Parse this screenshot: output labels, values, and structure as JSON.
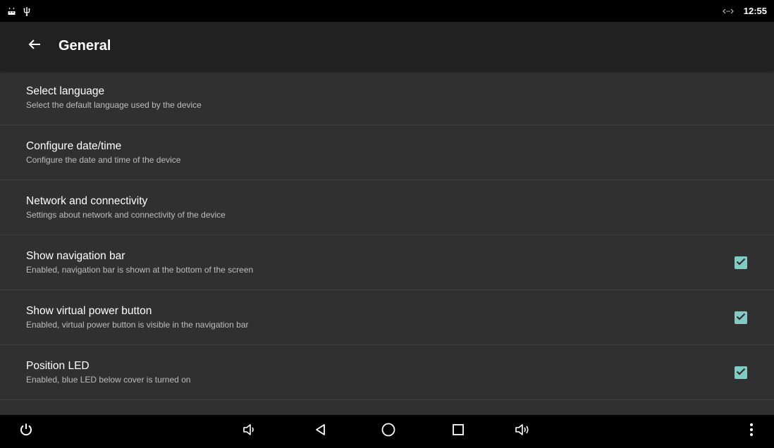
{
  "status_bar": {
    "time": "12:55",
    "left_icons": [
      "android-icon",
      "usb-icon"
    ],
    "right_icons": [
      "data-transfer-icon"
    ]
  },
  "action_bar": {
    "title": "General",
    "back_icon": "arrow-left-icon"
  },
  "settings": [
    {
      "title": "Select language",
      "summary": "Select the default language used by the device",
      "checkbox": null
    },
    {
      "title": "Configure date/time",
      "summary": "Configure the date and time of the device",
      "checkbox": null
    },
    {
      "title": "Network and connectivity",
      "summary": "Settings about network and connectivity of the device",
      "checkbox": null
    },
    {
      "title": "Show navigation bar",
      "summary": "Enabled, navigation bar is shown at the bottom of the screen",
      "checkbox": true
    },
    {
      "title": "Show virtual power button",
      "summary": "Enabled, virtual power button is visible in the navigation bar",
      "checkbox": true
    },
    {
      "title": "Position LED",
      "summary": "Enabled, blue LED below cover is turned on",
      "checkbox": true
    }
  ],
  "nav_bar": {
    "buttons": [
      "power-icon",
      "volume-down-icon",
      "back-icon",
      "home-icon",
      "recents-icon",
      "volume-up-icon",
      "more-vert-icon"
    ]
  },
  "colors": {
    "background": "#303030",
    "action_bar": "#212121",
    "status_bar": "#000000",
    "nav_bar": "#000000",
    "divider": "#3f3f3f",
    "summary_text": "#bdbdbd",
    "checkbox_accent": "#80cbc4"
  }
}
